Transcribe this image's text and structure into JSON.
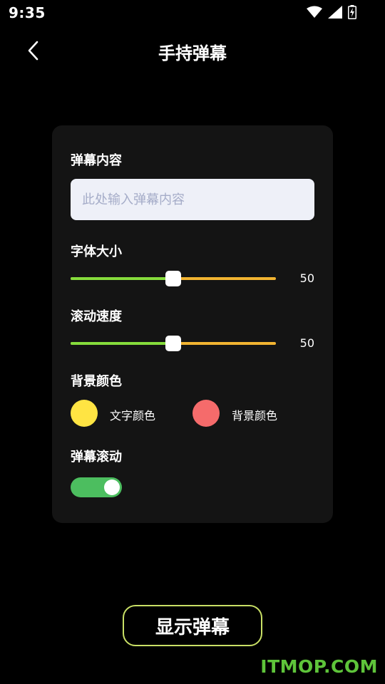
{
  "status_bar": {
    "time": "9:35",
    "icons": [
      "wifi-icon",
      "signal-icon",
      "battery-charging-icon"
    ]
  },
  "header": {
    "title": "手持弹幕",
    "back_icon": "chevron-left-icon"
  },
  "settings": {
    "content_label": "弹幕内容",
    "content_placeholder": "此处输入弹幕内容",
    "content_value": "",
    "font_size": {
      "label": "字体大小",
      "value": 50,
      "min": 0,
      "max": 100,
      "display": "50"
    },
    "scroll_speed": {
      "label": "滚动速度",
      "value": 50,
      "min": 0,
      "max": 100,
      "display": "50"
    },
    "background_color_label": "背景颜色",
    "text_color": {
      "label": "文字颜色",
      "color": "#ffe443"
    },
    "bg_color": {
      "label": "背景颜色",
      "color": "#f56b6b"
    },
    "scroll": {
      "label": "弹幕滚动",
      "enabled": true
    }
  },
  "actions": {
    "show_label": "显示弹幕"
  },
  "watermark": "ITMOP.COM",
  "colors": {
    "background": "#000000",
    "card": "#141414",
    "slider_left": "#86dc3c",
    "slider_right": "#f2b431",
    "toggle_on": "#4cbe5f",
    "button_border": "#c9e066"
  }
}
